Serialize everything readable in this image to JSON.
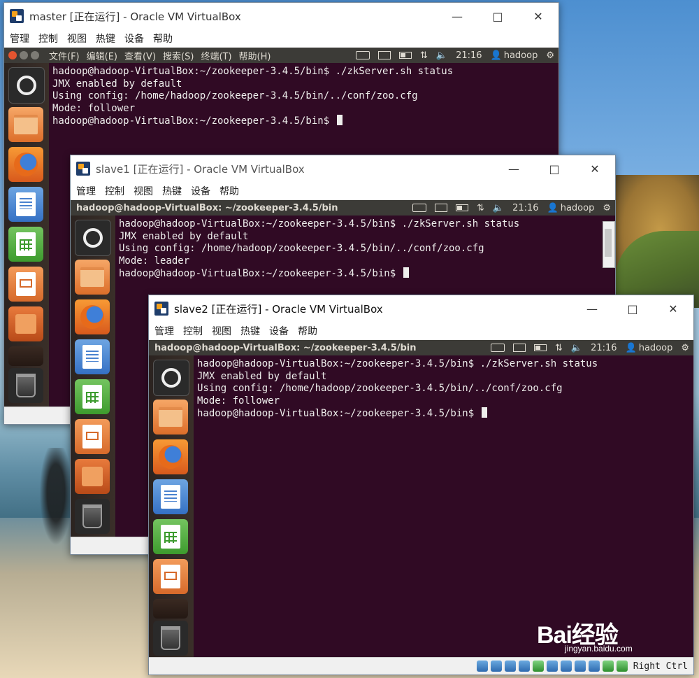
{
  "windows": {
    "master": {
      "title": "master [正在运行] - Oracle VM VirtualBox",
      "menu": [
        "管理",
        "控制",
        "视图",
        "热键",
        "设备",
        "帮助"
      ],
      "panel_menu": [
        "文件(F)",
        "编辑(E)",
        "查看(V)",
        "搜索(S)",
        "终端(T)",
        "帮助(H)"
      ],
      "clock": "21:16",
      "user": "hadoop",
      "terminal_lines": [
        "hadoop@hadoop-VirtualBox:~/zookeeper-3.4.5/bin$ ./zkServer.sh status",
        "JMX enabled by default",
        "Using config: /home/hadoop/zookeeper-3.4.5/bin/../conf/zoo.cfg",
        "Mode: follower",
        "hadoop@hadoop-VirtualBox:~/zookeeper-3.4.5/bin$ "
      ]
    },
    "slave1": {
      "title": "slave1 [正在运行] - Oracle VM VirtualBox",
      "menu": [
        "管理",
        "控制",
        "视图",
        "热键",
        "设备",
        "帮助"
      ],
      "panel_title": "hadoop@hadoop-VirtualBox: ~/zookeeper-3.4.5/bin",
      "clock": "21:16",
      "user": "hadoop",
      "terminal_lines": [
        "hadoop@hadoop-VirtualBox:~/zookeeper-3.4.5/bin$ ./zkServer.sh status",
        "JMX enabled by default",
        "Using config: /home/hadoop/zookeeper-3.4.5/bin/../conf/zoo.cfg",
        "Mode: leader",
        "hadoop@hadoop-VirtualBox:~/zookeeper-3.4.5/bin$ "
      ]
    },
    "slave2": {
      "title": "slave2 [正在运行] - Oracle VM VirtualBox",
      "menu": [
        "管理",
        "控制",
        "视图",
        "热键",
        "设备",
        "帮助"
      ],
      "panel_title": "hadoop@hadoop-VirtualBox: ~/zookeeper-3.4.5/bin",
      "clock": "21:16",
      "user": "hadoop",
      "terminal_lines": [
        "hadoop@hadoop-VirtualBox:~/zookeeper-3.4.5/bin$ ./zkServer.sh status",
        "JMX enabled by default",
        "Using config: /home/hadoop/zookeeper-3.4.5/bin/../conf/zoo.cfg",
        "Mode: follower",
        "hadoop@hadoop-VirtualBox:~/zookeeper-3.4.5/bin$ "
      ],
      "host_key": "Right Ctrl"
    }
  },
  "watermark": {
    "brand": "Bai经验",
    "url": "jingyan.baidu.com"
  },
  "colors": {
    "terminal_bg": "#300a24",
    "panel_bg": "#3c3b37",
    "close_dot": "#e3542f"
  }
}
